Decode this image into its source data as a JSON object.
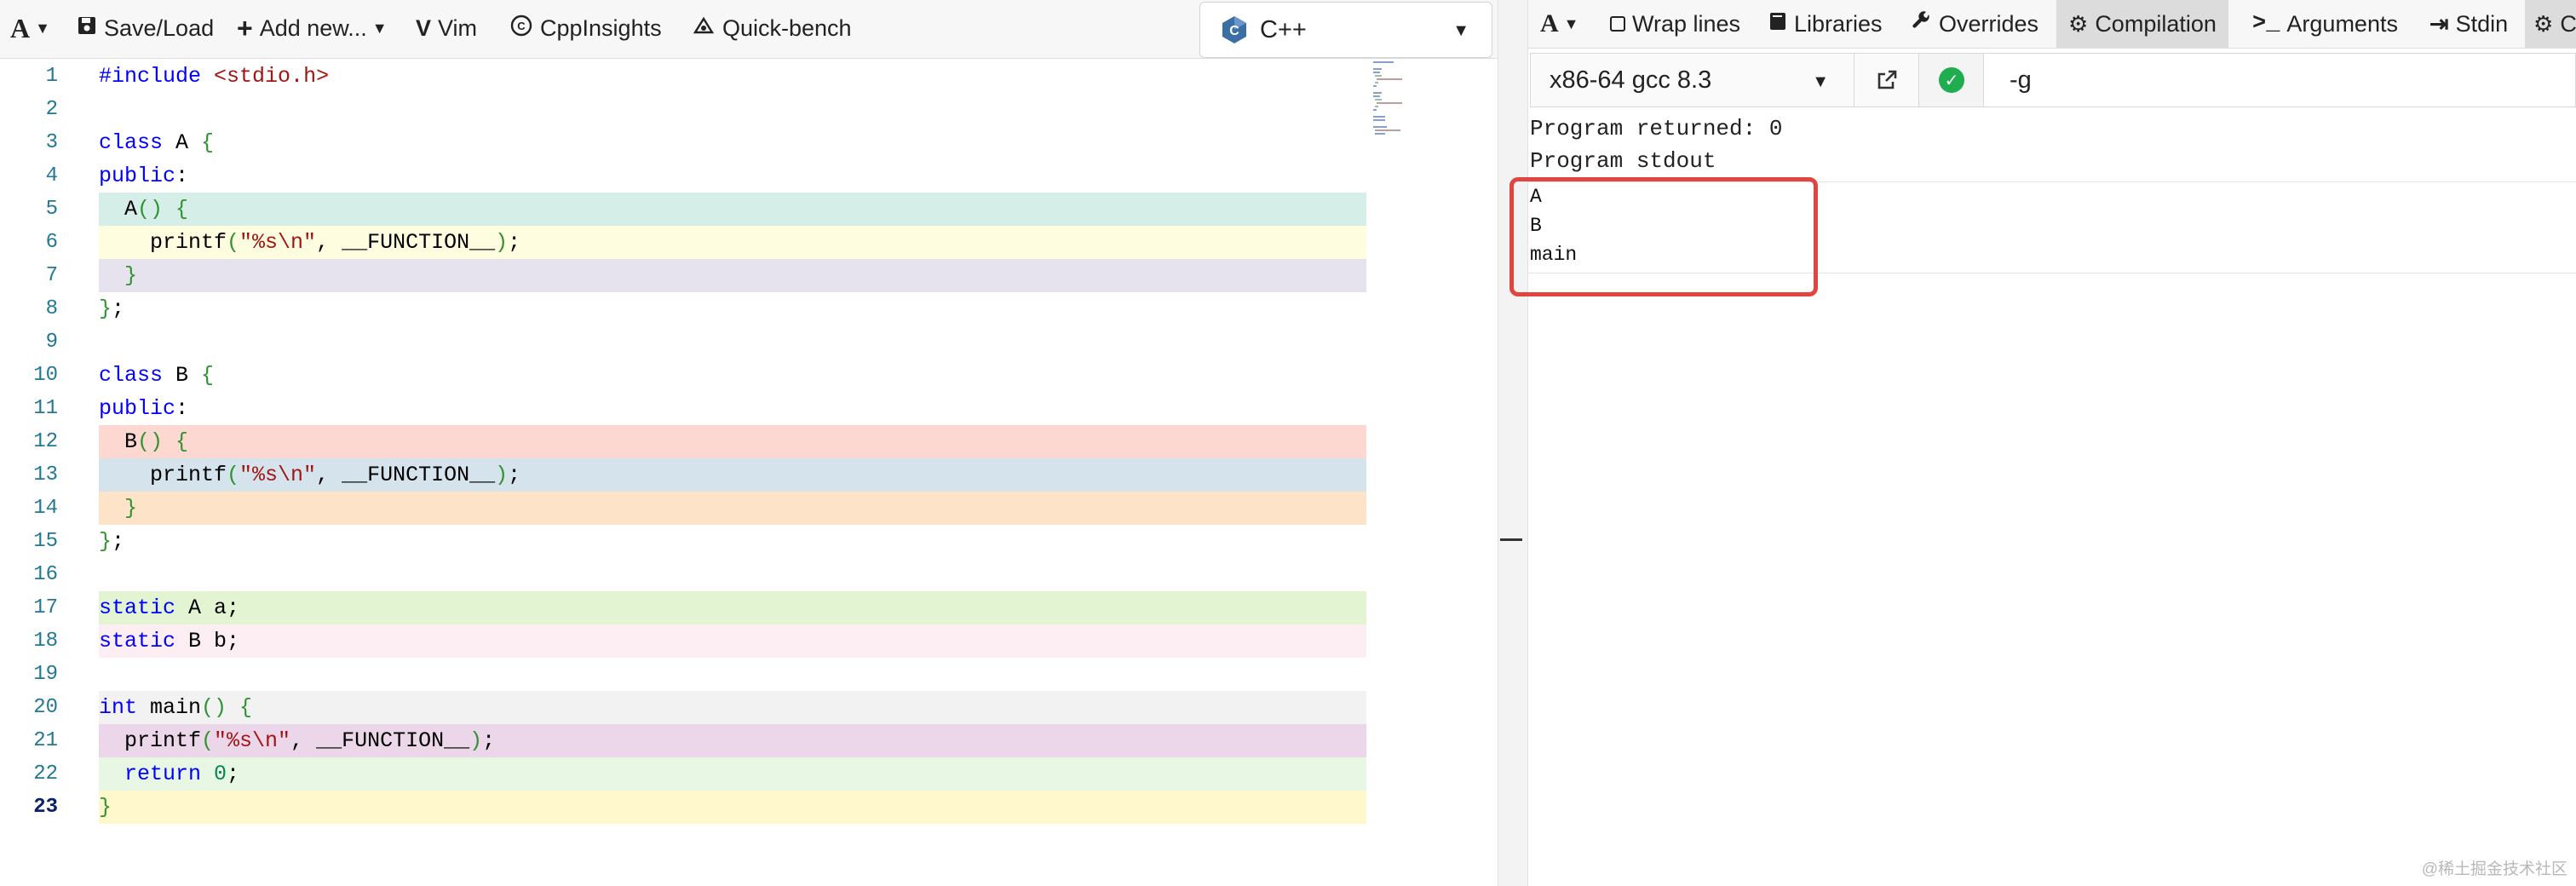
{
  "left_toolbar": {
    "font_label": "A",
    "items": [
      {
        "icon": "save-icon",
        "label": "Save/Load"
      },
      {
        "icon": "plus-icon",
        "label": "Add new..."
      },
      {
        "icon": "vim-icon",
        "label": "Vim"
      },
      {
        "icon": "cppinsights-icon",
        "label": "CppInsights"
      },
      {
        "icon": "quickbench-icon",
        "label": "Quick-bench"
      }
    ],
    "language": "C++"
  },
  "editor": {
    "current_line": 23,
    "lines": [
      {
        "n": "1",
        "bg": "#ffffff"
      },
      {
        "n": "2",
        "bg": "#ffffff"
      },
      {
        "n": "3",
        "bg": "#ffffff"
      },
      {
        "n": "4",
        "bg": "#ffffff"
      },
      {
        "n": "5",
        "bg": "#d5efe8"
      },
      {
        "n": "6",
        "bg": "#fffde0"
      },
      {
        "n": "7",
        "bg": "#e6e3ef"
      },
      {
        "n": "8",
        "bg": "#ffffff"
      },
      {
        "n": "9",
        "bg": "#ffffff"
      },
      {
        "n": "10",
        "bg": "#ffffff"
      },
      {
        "n": "11",
        "bg": "#ffffff"
      },
      {
        "n": "12",
        "bg": "#fdd8d0"
      },
      {
        "n": "13",
        "bg": "#d4e3ec"
      },
      {
        "n": "14",
        "bg": "#fde3c8"
      },
      {
        "n": "15",
        "bg": "#ffffff"
      },
      {
        "n": "16",
        "bg": "#ffffff"
      },
      {
        "n": "17",
        "bg": "#e3f4d3"
      },
      {
        "n": "18",
        "bg": "#fdeef3"
      },
      {
        "n": "19",
        "bg": "#ffffff"
      },
      {
        "n": "20",
        "bg": "#f2f2f2"
      },
      {
        "n": "21",
        "bg": "#ecd6ea"
      },
      {
        "n": "22",
        "bg": "#e8f7e4"
      },
      {
        "n": "23",
        "bg": "#fff8cc"
      }
    ],
    "code": {
      "l1_pp": "#include",
      "l1_hdr": "<stdio.h>",
      "l3_kw": "class",
      "l3_rest": " A ",
      "l3_br": "{",
      "l4_kw": "public",
      "l4_rest": ":",
      "l5_name": "  A",
      "l5_br": "() {",
      "l6_fn": "    printf",
      "l6_p1": "(",
      "l6_str": "\"%s\\n\"",
      "l6_rest": ", __FUNCTION__",
      "l6_p2": ")",
      "l6_end": ";",
      "l7_br": "  }",
      "l8_br": "}",
      "l8_end": ";",
      "l10_kw": "class",
      "l10_rest": " B ",
      "l10_br": "{",
      "l11_kw": "public",
      "l11_rest": ":",
      "l12_name": "  B",
      "l12_br": "() {",
      "l13_fn": "    printf",
      "l13_p1": "(",
      "l13_str": "\"%s\\n\"",
      "l13_rest": ", __FUNCTION__",
      "l13_p2": ")",
      "l13_end": ";",
      "l14_br": "  }",
      "l15_br": "}",
      "l15_end": ";",
      "l17_kw": "static",
      "l17_rest": " A a;",
      "l18_kw": "static",
      "l18_rest": " B b;",
      "l20_kw": "int",
      "l20_rest": " main",
      "l20_br": "() {",
      "l21_fn": "  printf",
      "l21_p1": "(",
      "l21_str": "\"%s\\n\"",
      "l21_rest": ", __FUNCTION__",
      "l21_p2": ")",
      "l21_end": ";",
      "l22_kw": "  return",
      "l22_num": " 0",
      "l22_end": ";",
      "l23_br": "}"
    }
  },
  "right_toolbar": {
    "font_label": "A",
    "items": [
      {
        "icon": "checkbox-icon",
        "label": "Wrap lines"
      },
      {
        "icon": "book-icon",
        "label": "Libraries"
      },
      {
        "icon": "wrench-icon",
        "label": "Overrides"
      },
      {
        "icon": "gears-icon",
        "label": "Compilation"
      },
      {
        "icon": "terminal-icon",
        "label": "Arguments"
      },
      {
        "icon": "login-icon",
        "label": "Stdin"
      },
      {
        "icon": "gears-icon",
        "label": "C"
      }
    ]
  },
  "compiler": {
    "name": "x86-64 gcc 8.3",
    "flags": "-g"
  },
  "output": {
    "returned": "Program returned: 0",
    "stdout_header": "Program stdout",
    "stdout_lines": [
      "A",
      "B",
      "main"
    ]
  },
  "watermark": "@稀土掘金技术社区",
  "colors": {
    "highlight": "#e0463f",
    "status_ok": "#1fad50",
    "keyword": "#0000ff",
    "string": "#a31515"
  }
}
